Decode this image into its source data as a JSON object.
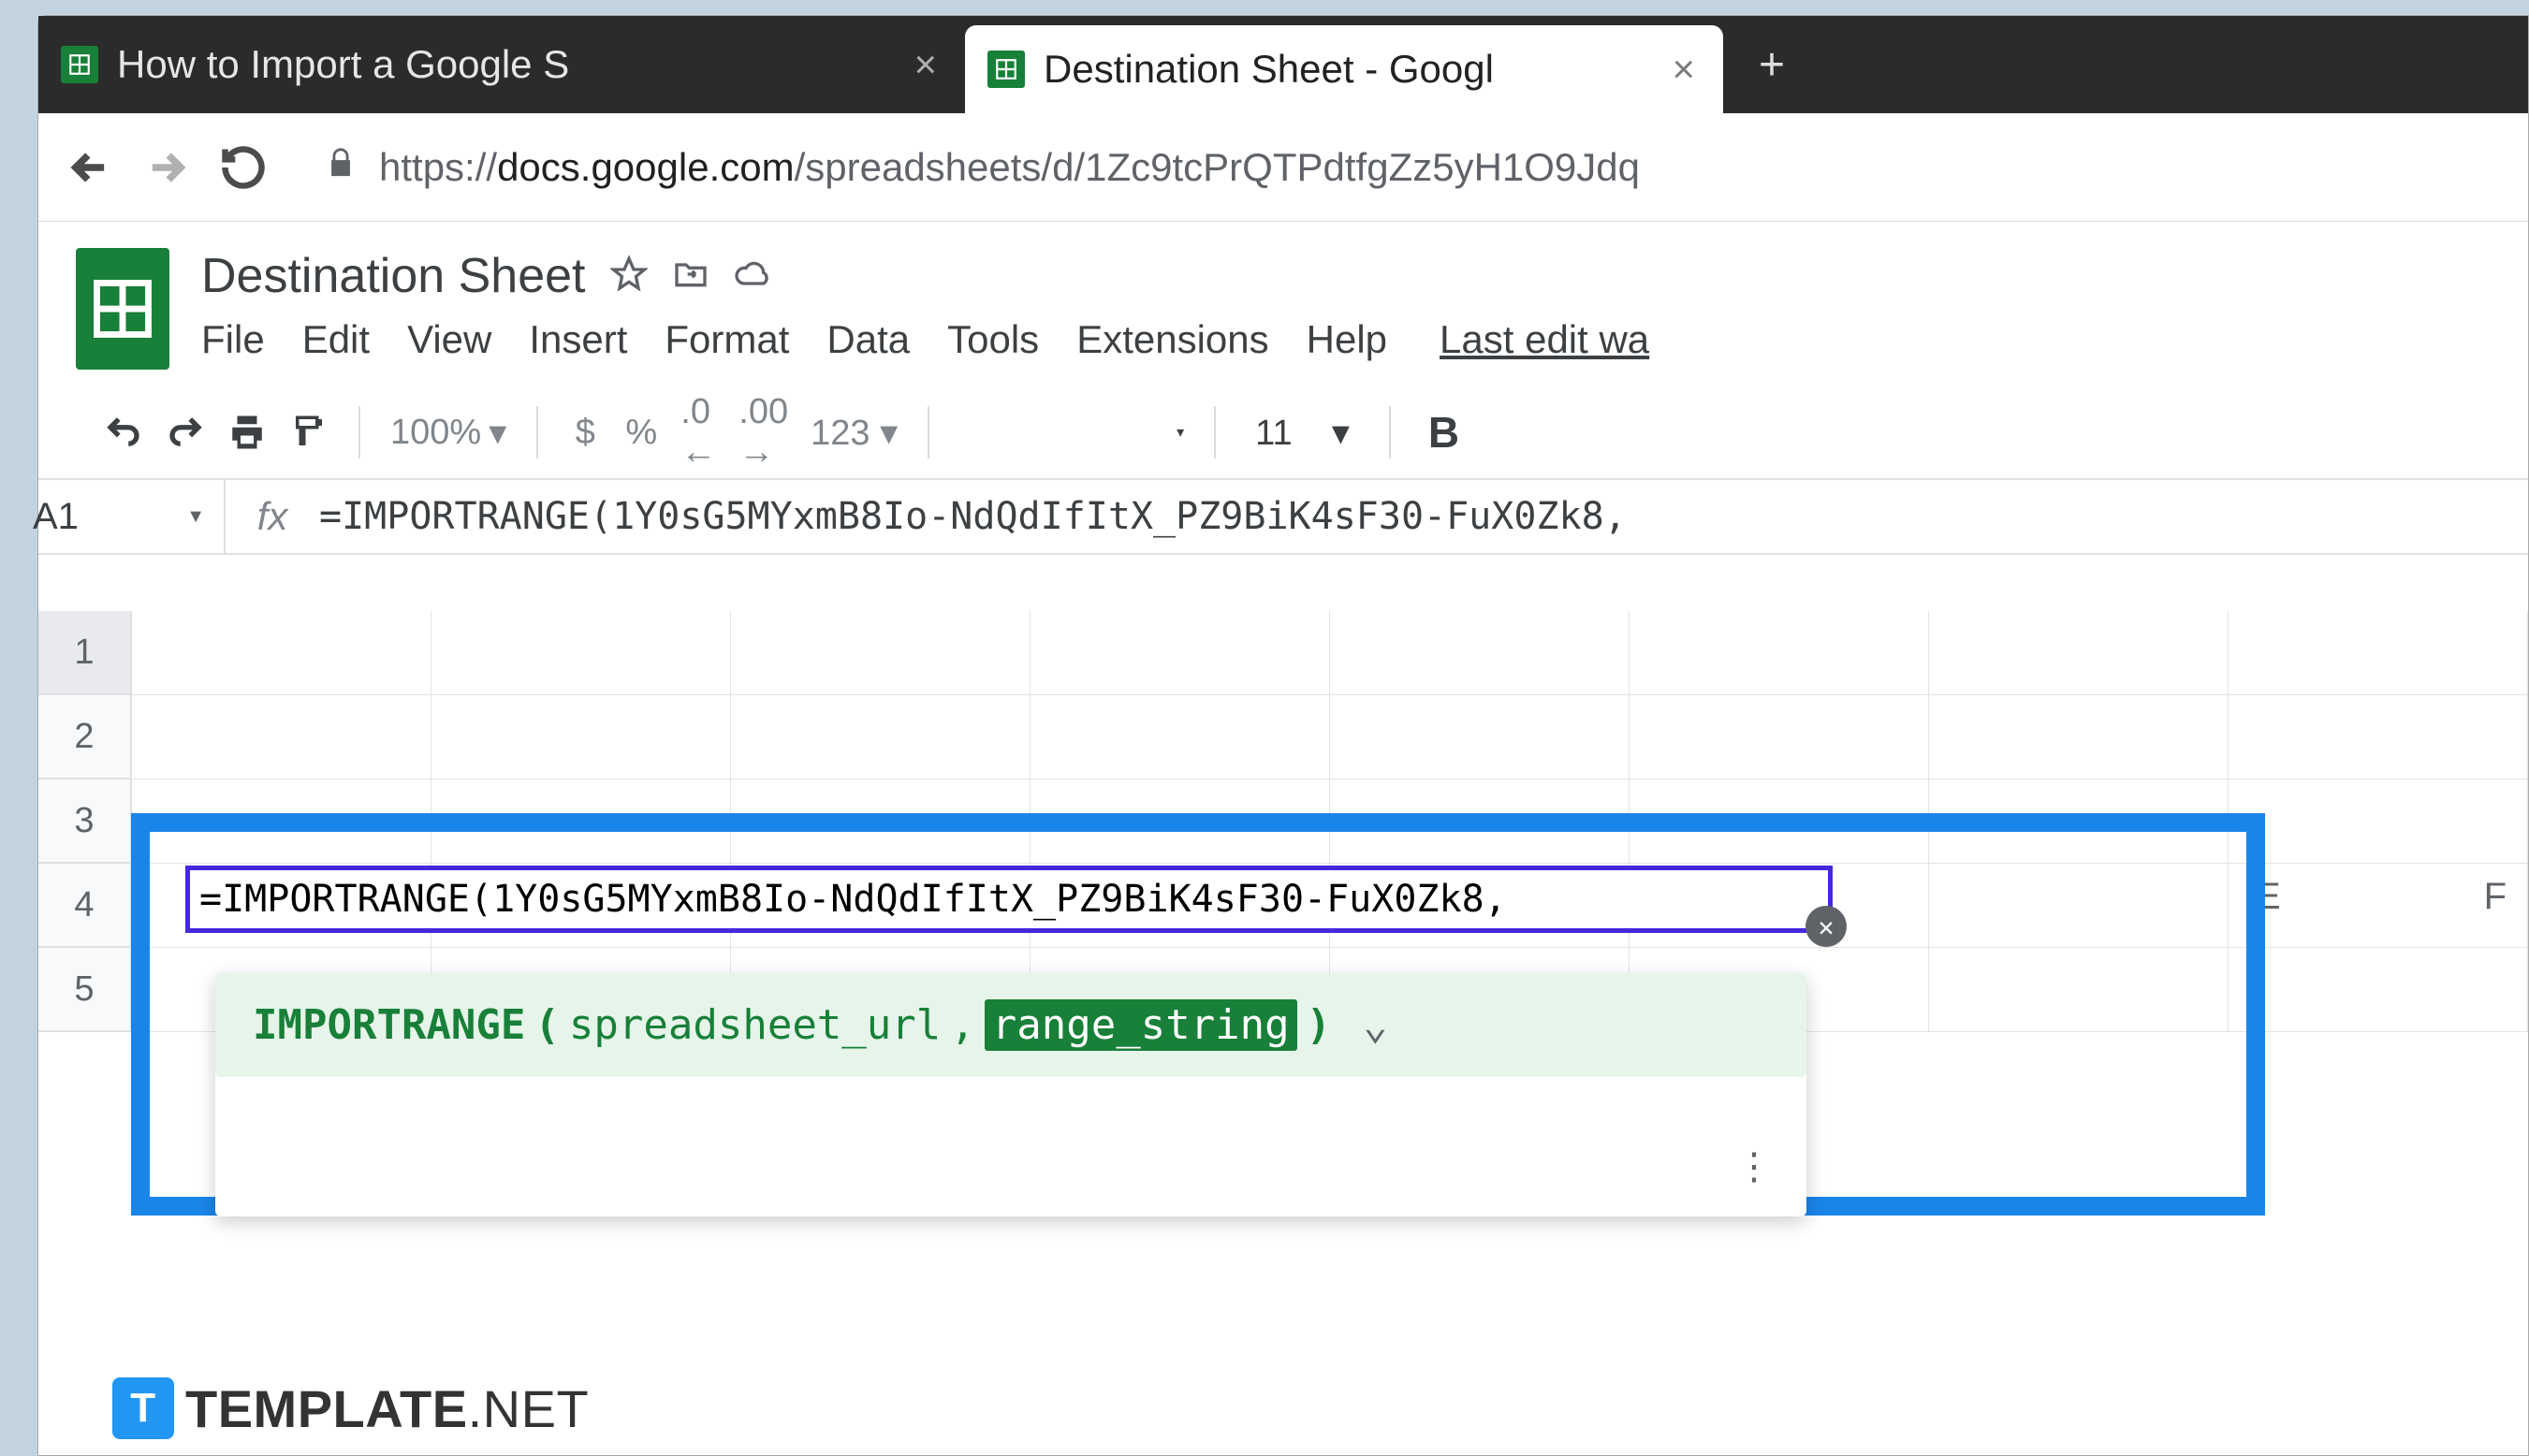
{
  "tabs": [
    {
      "title": "How to Import a Google S",
      "active": false
    },
    {
      "title": "Destination Sheet - Googl",
      "active": true
    }
  ],
  "url": {
    "prefix": "https://",
    "host": "docs.google.com",
    "path": "/spreadsheets/d/1Zc9tcPrQTPdtfgZz5yH1O9Jdq"
  },
  "doc": {
    "title": "Destination Sheet",
    "menus": [
      "File",
      "Edit",
      "View",
      "Insert",
      "Format",
      "Data",
      "Tools",
      "Extensions",
      "Help"
    ],
    "last_edit": "Last edit wa"
  },
  "toolbar": {
    "zoom": "100%",
    "font_size": "11"
  },
  "formula": {
    "cell_ref": "A1",
    "bar_text": "=IMPORTRANGE(1Y0sG5MYxmB8Io-NdQdIfItX_PZ9BiK4sF30-FuX0Zk8,",
    "cell_text": "=IMPORTRANGE(1Y0sG5MYxmB8Io-NdQdIfItX_PZ9BiK4sF30-FuX0Zk8,",
    "hint_fn": "IMPORTRANGE",
    "hint_p1": "spreadsheet_url",
    "hint_p2": "range_string"
  },
  "rows": [
    "1",
    "2",
    "3",
    "4",
    "5"
  ],
  "cols": [
    "E",
    "F"
  ],
  "watermark": {
    "brand": "TEMPLATE",
    "suffix": ".NET",
    "logo_letter": "T"
  }
}
